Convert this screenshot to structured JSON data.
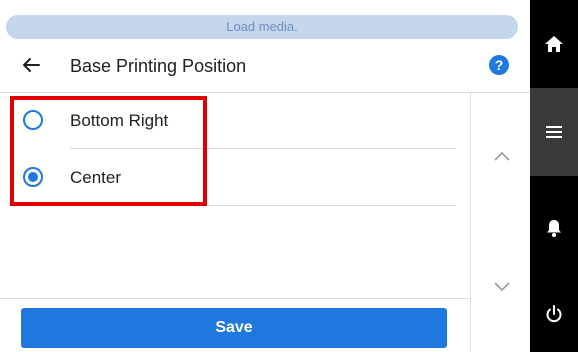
{
  "status": {
    "message": "Load media."
  },
  "header": {
    "title": "Base Printing Position"
  },
  "options": [
    {
      "label": "Bottom Right",
      "selected": false
    },
    {
      "label": "Center",
      "selected": true
    }
  ],
  "actions": {
    "save_label": "Save"
  },
  "sidebar": {
    "items": [
      {
        "icon": "home-icon",
        "active": false
      },
      {
        "icon": "menu-icon",
        "active": true
      },
      {
        "icon": "bell-icon",
        "active": false
      },
      {
        "icon": "power-icon",
        "active": false
      }
    ]
  },
  "colors": {
    "accent": "#1f78de",
    "highlight": "#e00000",
    "status_bg": "#c5d6ec",
    "sidebar_bg": "#000000"
  }
}
